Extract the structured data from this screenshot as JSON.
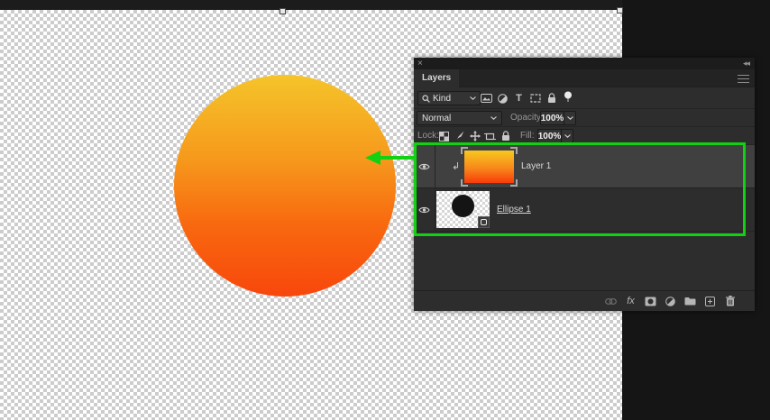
{
  "annotation": {
    "color": "#12d112"
  },
  "canvas": {
    "circle_gradient_top": "#F5C42A",
    "circle_gradient_bottom": "#F8470C",
    "handles": [
      "top-mid-transform-handle",
      "top-right-transform-handle"
    ]
  },
  "panel": {
    "title": "Layers",
    "header_icons": [
      "close-icon",
      "collapse-panel-icon",
      "panel-menu-icon"
    ],
    "filter": {
      "kind_label": "Kind",
      "icons": [
        "pixel-layer-filter",
        "adjustment-layer-filter",
        "type-layer-filter",
        "shape-layer-filter",
        "lock-filter",
        "filter-pin"
      ],
      "type_glyph": "T"
    },
    "blend": {
      "mode": "Normal",
      "opacity_label": "Opacity:",
      "opacity_value": "100%"
    },
    "lock": {
      "lock_label": "Lock:",
      "icons": [
        "lock-transparency",
        "lock-paint",
        "lock-position",
        "lock-artboard",
        "lock-all"
      ],
      "fill_label": "Fill:",
      "fill_value": "100%"
    },
    "layers": [
      {
        "name": "Layer 1",
        "selected": true,
        "clipped": true,
        "clip_glyph": "↲"
      },
      {
        "name": "Ellipse 1",
        "underlined": true
      }
    ],
    "bottom": {
      "fx_label": "fx",
      "icons": [
        "link-layers",
        "layer-style-fx",
        "add-layer-mask",
        "new-adjustment-layer",
        "new-group",
        "new-layer",
        "delete-layer"
      ]
    }
  }
}
